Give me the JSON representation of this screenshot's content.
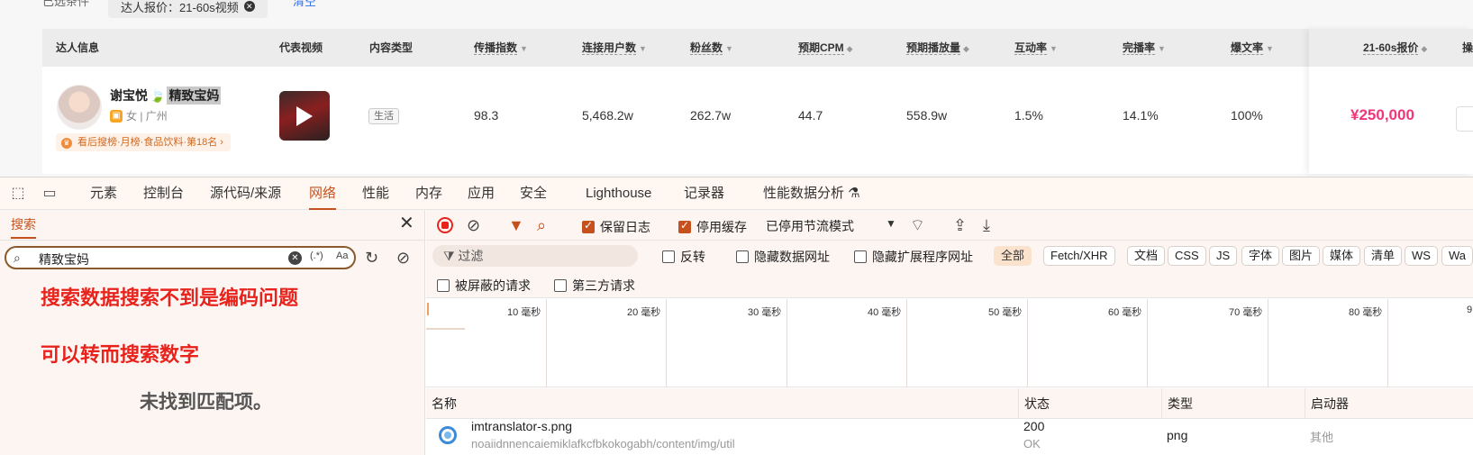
{
  "page": {
    "filter_label": "已选条件",
    "filter_chip": "达人报价：21-60s视频",
    "filter_clear": "清空",
    "columns": [
      "达人信息",
      "代表视频",
      "内容类型",
      "传播指数",
      "连接用户数",
      "粉丝数",
      "预期CPM",
      "预期播放量",
      "互动率",
      "完播率",
      "爆文率",
      "21-60s报价",
      "操"
    ],
    "row": {
      "name": "谢宝悦",
      "name_highlight": "精致宝妈",
      "gender_city": "女 | 广州",
      "rank": "看后搜榜·月榜·食品饮料·第18名 ›",
      "content_type": "生活",
      "spread_index": "98.3",
      "connected_users": "5,468.2w",
      "fans": "262.7w",
      "cpm": "44.7",
      "expected_plays": "558.9w",
      "interaction_rate": "1.5%",
      "completion_rate": "14.1%",
      "viral_rate": "100%",
      "price": "¥250,000"
    }
  },
  "devtools": {
    "tabs": [
      "元素",
      "控制台",
      "源代码/来源",
      "网络",
      "性能",
      "内存",
      "应用",
      "安全",
      "Lighthouse",
      "记录器",
      "性能数据分析 ⚗"
    ],
    "active_tab": "网络",
    "search": {
      "title": "搜索",
      "query": "精致宝妈",
      "regex_label": "(.*)",
      "case_label": "Aa",
      "annotation_1": "搜索数据搜索不到是编码问题",
      "annotation_2": "可以转而搜索数字",
      "ghost_text": "未找到匹配项。"
    },
    "network": {
      "preserve_log": "保留日志",
      "disable_cache": "停用缓存",
      "throttling": "已停用节流模式",
      "filter_placeholder": "过滤",
      "invert": "反转",
      "hide_data_urls": "隐藏数据网址",
      "hide_extension_urls": "隐藏扩展程序网址",
      "type_filters": [
        "全部",
        "Fetch/XHR",
        "文档",
        "CSS",
        "JS",
        "字体",
        "图片",
        "媒体",
        "清单",
        "WS",
        "Wa"
      ],
      "blocked_requests": "被屏蔽的请求",
      "third_party": "第三方请求",
      "timeline_ticks": [
        "10 毫秒",
        "20 毫秒",
        "30 毫秒",
        "40 毫秒",
        "50 毫秒",
        "60 毫秒",
        "70 毫秒",
        "80 毫秒",
        "9"
      ],
      "table_headers": [
        "名称",
        "状态",
        "类型",
        "启动器"
      ],
      "request": {
        "name": "imtranslator-s.png",
        "path": "noaiidnnencaiemiklafkcfbkokogabh/content/img/util",
        "status": "200",
        "status_text": "OK",
        "type": "png",
        "initiator": "其他"
      }
    }
  }
}
